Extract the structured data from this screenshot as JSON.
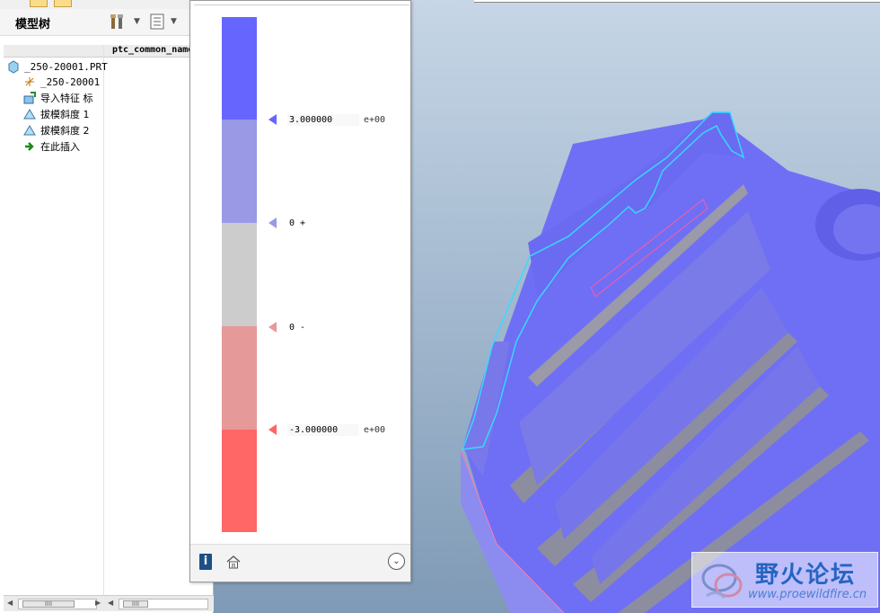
{
  "model_tree": {
    "title": "模型树",
    "column_header": "ptc_common_name",
    "items": [
      {
        "label": "_250-20001.PRT",
        "icon": "part-icon"
      },
      {
        "label": "_250-20001",
        "icon": "coordinate-system-icon"
      },
      {
        "label": "导入特征 标",
        "icon": "import-feature-icon"
      },
      {
        "label": "拔模斜度 1",
        "icon": "draft-icon"
      },
      {
        "label": "拔模斜度 2",
        "icon": "draft-icon"
      },
      {
        "label": "在此插入",
        "icon": "insert-here-arrow-icon"
      }
    ],
    "scrollbar_grip": "IIII"
  },
  "legend": {
    "ticks": [
      {
        "value": "3.000000",
        "exp": "e+00",
        "color": "#6666ff"
      },
      {
        "value": "0 +",
        "exp": "",
        "color": "#9999e6"
      },
      {
        "value": "0 -",
        "exp": "",
        "color": "#e69999"
      },
      {
        "value": "-3.000000",
        "exp": "e+00",
        "color": "#ff6666"
      }
    ],
    "bands": [
      "#6666ff",
      "#9999e6",
      "#cccccc",
      "#e69999",
      "#ff6666"
    ],
    "info_label": "i",
    "expand_label": "⌄"
  },
  "watermark": {
    "title": "野火论坛",
    "url": "www.proewildfire.cn"
  },
  "colors": {
    "draft_positive": "#6666ff",
    "draft_negative": "#ff6666",
    "edge_highlight": "#33ddff",
    "viewport_top": "#c6d6e6",
    "viewport_bottom": "#7f9ab6"
  }
}
